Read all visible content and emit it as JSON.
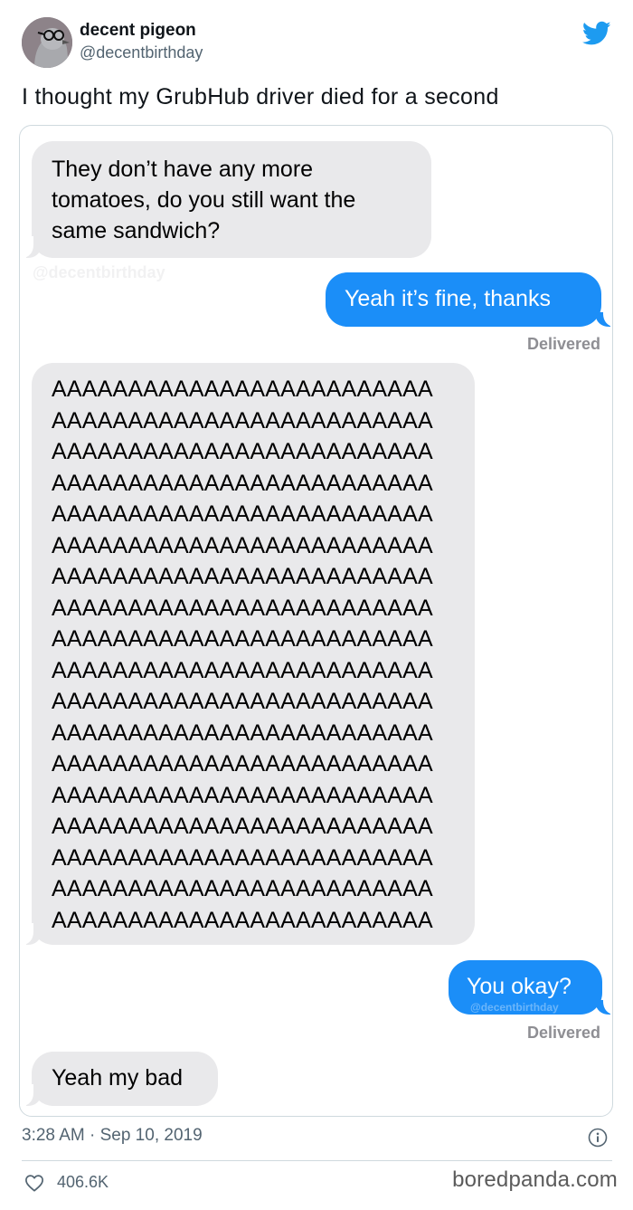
{
  "tweet": {
    "display_name": "decent pigeon",
    "handle": "@decentbirthday",
    "text": "I thought my GrubHub driver died for a second",
    "timestamp": "3:28 AM · Sep 10, 2019",
    "likes": "406.6K",
    "avatar_icon": "pigeon-with-glasses-avatar",
    "brand_icon": "twitter-bird-icon",
    "brand_color": "#1d9bf0"
  },
  "conversation": {
    "msg1": "They don’t have any more tomatoes, do you still want the same sandwich?",
    "msg2": "Yeah it’s fine, thanks",
    "delivered_1": "Delivered",
    "msg3_lines": [
      "AAAAAAAAAAAAAAAAAAAAAAAAA",
      "AAAAAAAAAAAAAAAAAAAAAAAAA",
      "AAAAAAAAAAAAAAAAAAAAAAAAA",
      "AAAAAAAAAAAAAAAAAAAAAAAAA",
      "AAAAAAAAAAAAAAAAAAAAAAAAA",
      "AAAAAAAAAAAAAAAAAAAAAAAAA",
      "AAAAAAAAAAAAAAAAAAAAAAAAA",
      "AAAAAAAAAAAAAAAAAAAAAAAAA",
      "AAAAAAAAAAAAAAAAAAAAAAAAA",
      "AAAAAAAAAAAAAAAAAAAAAAAAA",
      "AAAAAAAAAAAAAAAAAAAAAAAAA",
      "AAAAAAAAAAAAAAAAAAAAAAAAA",
      "AAAAAAAAAAAAAAAAAAAAAAAAA",
      "AAAAAAAAAAAAAAAAAAAAAAAAA",
      "AAAAAAAAAAAAAAAAAAAAAAAAA",
      "AAAAAAAAAAAAAAAAAAAAAAAAA",
      "AAAAAAAAAAAAAAAAAAAAAAAAA",
      "AAAAAAAAAAAAAAAAAAAAAAAAA"
    ],
    "msg4": "You okay?",
    "delivered_2": "Delivered",
    "msg5": "Yeah my bad",
    "incoming_color": "#e9e9eb",
    "outgoing_color": "#1b8ef8",
    "watermark": "@decentbirthday"
  },
  "footer": {
    "info_icon": "info-icon",
    "heart_icon": "heart-icon",
    "site": "boredpanda.com"
  }
}
